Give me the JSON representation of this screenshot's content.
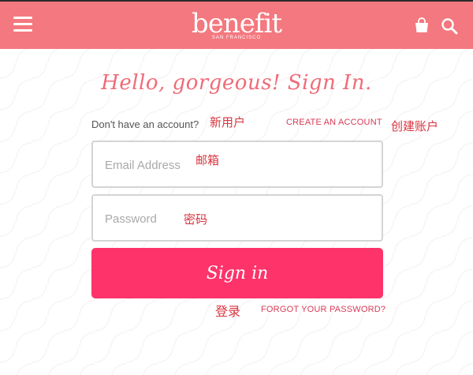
{
  "header": {
    "brand": "benefit",
    "brand_sub": "SAN FRANCISCO",
    "bg_color": "#f4787f"
  },
  "icons": {
    "menu": "hamburger-menu-icon",
    "bag": "shopping-bag-icon",
    "search": "search-icon"
  },
  "login": {
    "greeting": "Hello, gorgeous! Sign In.",
    "no_account_text": "Don't have an account?",
    "no_account_cn": "新用户",
    "create_account_label": "CREATE AN ACCOUNT",
    "create_account_cn": "创建账户",
    "email_placeholder": "Email Address",
    "email_cn": "邮箱",
    "password_placeholder": "Password",
    "password_cn": "密码",
    "signin_label": "Sign in",
    "signin_cn": "登录",
    "forgot_label": "FORGOT YOUR PASSWORD?",
    "accent_color": "#fd336a"
  }
}
